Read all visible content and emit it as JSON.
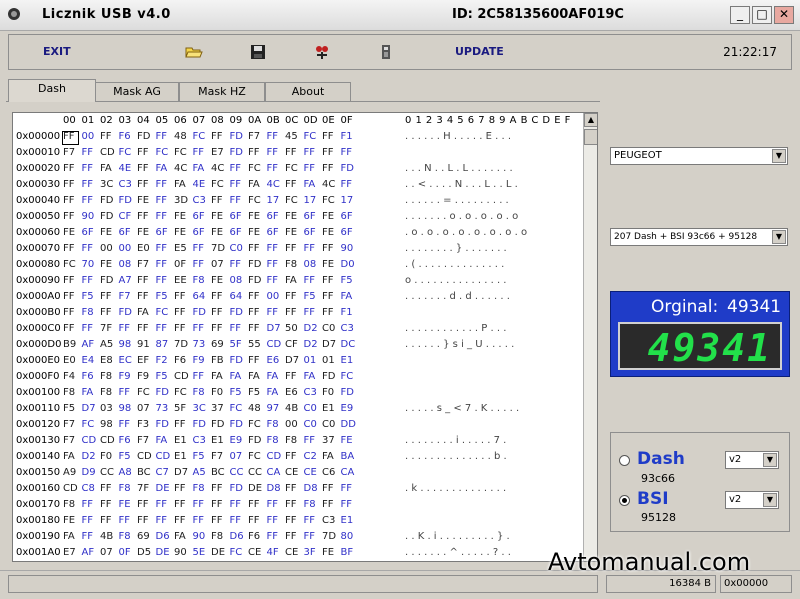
{
  "window": {
    "title": "Licznik USB  v4.0",
    "device_id": "ID:  2C58135600AF019C",
    "minimize": "_",
    "maximize": "□",
    "close": "✕"
  },
  "toolbar": {
    "exit_label": "EXIT",
    "update_label": "UPDATE",
    "clock": "21:22:17",
    "icons": [
      "open-folder-icon",
      "save-disk-icon",
      "connect-icon",
      "device-icon"
    ]
  },
  "tabs": [
    "Dash",
    "Mask AG",
    "Mask HZ",
    "About"
  ],
  "active_tab": "Dash",
  "hex": {
    "col_headers": [
      "00",
      "01",
      "02",
      "03",
      "04",
      "05",
      "06",
      "07",
      "08",
      "09",
      "0A",
      "0B",
      "0C",
      "0D",
      "0E",
      "0F"
    ],
    "ascii_header": "0123456789ABCDEF",
    "rows": [
      {
        "addr": "0x00000",
        "bytes": [
          "FF",
          "00",
          "FF",
          "F6",
          "FD",
          "FF",
          "48",
          "FC",
          "FF",
          "FD",
          "F7",
          "FF",
          "45",
          "FC",
          "FF",
          "F1"
        ],
        "ascii": ". . . . . . H . . . . . E . . ."
      },
      {
        "addr": "0x00010",
        "bytes": [
          "F7",
          "FF",
          "CD",
          "FC",
          "FF",
          "FC",
          "FC",
          "FF",
          "E7",
          "FD",
          "FF",
          "FF",
          "FF",
          "FF",
          "FF",
          "FF"
        ],
        "ascii": ""
      },
      {
        "addr": "0x00020",
        "bytes": [
          "FF",
          "FF",
          "FA",
          "4E",
          "FF",
          "FA",
          "4C",
          "FA",
          "4C",
          "FF",
          "FC",
          "FF",
          "FC",
          "FF",
          "FF",
          "FD"
        ],
        "ascii": ". . . N . . L . L . . . . . . ."
      },
      {
        "addr": "0x00030",
        "bytes": [
          "FF",
          "FF",
          "3C",
          "C3",
          "FF",
          "FF",
          "FA",
          "4E",
          "FC",
          "FF",
          "FA",
          "4C",
          "FF",
          "FA",
          "4C",
          "FF"
        ],
        "ascii": ". . < . . . . N . . . L . . L ."
      },
      {
        "addr": "0x00040",
        "bytes": [
          "FF",
          "FF",
          "FD",
          "FD",
          "FE",
          "FF",
          "3D",
          "C3",
          "FF",
          "FF",
          "FC",
          "17",
          "FC",
          "17",
          "FC",
          "17"
        ],
        "ascii": ". . . . . . = . . . . . . . . ."
      },
      {
        "addr": "0x00050",
        "bytes": [
          "FF",
          "90",
          "FD",
          "CF",
          "FF",
          "FF",
          "FE",
          "6F",
          "FE",
          "6F",
          "FE",
          "6F",
          "FE",
          "6F",
          "FE",
          "6F"
        ],
        "ascii": ". . . . . . . o . o . o . o . o"
      },
      {
        "addr": "0x00060",
        "bytes": [
          "FE",
          "6F",
          "FE",
          "6F",
          "FE",
          "6F",
          "FE",
          "6F",
          "FE",
          "6F",
          "FE",
          "6F",
          "FE",
          "6F",
          "FE",
          "6F"
        ],
        "ascii": ". o . o . o . o . o . o . o . o"
      },
      {
        "addr": "0x00070",
        "bytes": [
          "FF",
          "FF",
          "00",
          "00",
          "E0",
          "FF",
          "E5",
          "FF",
          "7D",
          "C0",
          "FF",
          "FF",
          "FF",
          "FF",
          "FF",
          "90"
        ],
        "ascii": ". . . . . . . . } . . . . . . ."
      },
      {
        "addr": "0x00080",
        "bytes": [
          "FC",
          "70",
          "FE",
          "08",
          "F7",
          "FF",
          "0F",
          "FF",
          "07",
          "FF",
          "FD",
          "FF",
          "F8",
          "08",
          "FE",
          "D0"
        ],
        "ascii": ". ( . . . . . . . . . . . . . ."
      },
      {
        "addr": "0x00090",
        "bytes": [
          "FF",
          "FF",
          "FD",
          "A7",
          "FF",
          "FF",
          "EE",
          "F8",
          "FE",
          "08",
          "FD",
          "FF",
          "FA",
          "FF",
          "FF",
          "F5"
        ],
        "ascii": "o . . . . . . . . . . . . . . ."
      },
      {
        "addr": "0x000A0",
        "bytes": [
          "FF",
          "F5",
          "FF",
          "F7",
          "FF",
          "F5",
          "FF",
          "64",
          "FF",
          "64",
          "FF",
          "00",
          "FF",
          "F5",
          "FF",
          "FA"
        ],
        "ascii": ". . . . . . . d . d . . . . . ."
      },
      {
        "addr": "0x000B0",
        "bytes": [
          "FF",
          "F8",
          "FF",
          "FD",
          "FA",
          "FC",
          "FF",
          "FD",
          "FF",
          "FD",
          "FF",
          "FF",
          "FF",
          "FF",
          "FF",
          "F1"
        ],
        "ascii": ""
      },
      {
        "addr": "0x000C0",
        "bytes": [
          "FF",
          "FF",
          "7F",
          "FF",
          "FF",
          "FF",
          "FF",
          "FF",
          "FF",
          "FF",
          "FF",
          "D7",
          "50",
          "D2",
          "C0",
          "C3"
        ],
        "ascii": ". . . . . . . . . . . . P . . ."
      },
      {
        "addr": "0x000D0",
        "bytes": [
          "B9",
          "AF",
          "A5",
          "98",
          "91",
          "87",
          "7D",
          "73",
          "69",
          "5F",
          "55",
          "CD",
          "CF",
          "D2",
          "D7",
          "DC"
        ],
        "ascii": ". . . . . . } s i _ U . . . . ."
      },
      {
        "addr": "0x000E0",
        "bytes": [
          "E0",
          "E4",
          "E8",
          "EC",
          "EF",
          "F2",
          "F6",
          "F9",
          "FB",
          "FD",
          "FF",
          "E6",
          "D7",
          "01",
          "01",
          "E1"
        ],
        "ascii": ""
      },
      {
        "addr": "0x000F0",
        "bytes": [
          "F4",
          "F6",
          "F8",
          "F9",
          "F9",
          "F5",
          "CD",
          "FF",
          "FA",
          "FA",
          "FA",
          "FA",
          "FF",
          "FA",
          "FD",
          "FC"
        ],
        "ascii": ""
      },
      {
        "addr": "0x00100",
        "bytes": [
          "F8",
          "FA",
          "F8",
          "FF",
          "FC",
          "FD",
          "FC",
          "F8",
          "F0",
          "F5",
          "F5",
          "FA",
          "E6",
          "C3",
          "F0",
          "FD"
        ],
        "ascii": ""
      },
      {
        "addr": "0x00110",
        "bytes": [
          "F5",
          "D7",
          "03",
          "98",
          "07",
          "73",
          "5F",
          "3C",
          "37",
          "FC",
          "48",
          "97",
          "4B",
          "C0",
          "E1",
          "E9"
        ],
        "ascii": ". . . . . s _ < 7 . K . . . . ."
      },
      {
        "addr": "0x00120",
        "bytes": [
          "F7",
          "FC",
          "98",
          "FF",
          "F3",
          "FD",
          "FF",
          "FD",
          "FD",
          "FD",
          "FC",
          "F8",
          "00",
          "C0",
          "C0",
          "DD"
        ],
        "ascii": ""
      },
      {
        "addr": "0x00130",
        "bytes": [
          "F7",
          "CD",
          "CD",
          "F6",
          "F7",
          "FA",
          "E1",
          "C3",
          "E1",
          "E9",
          "FD",
          "F8",
          "F8",
          "FF",
          "37",
          "FE"
        ],
        "ascii": ". . . . . . . . i . . . . . 7 ."
      },
      {
        "addr": "0x00140",
        "bytes": [
          "FA",
          "D2",
          "F0",
          "F5",
          "CD",
          "CD",
          "E1",
          "F5",
          "F7",
          "07",
          "FC",
          "CD",
          "FF",
          "C2",
          "FA",
          "BA"
        ],
        "ascii": ". . . . . . . . . . . . . . b ."
      },
      {
        "addr": "0x00150",
        "bytes": [
          "A9",
          "D9",
          "CC",
          "A8",
          "BC",
          "C7",
          "D7",
          "A5",
          "BC",
          "CC",
          "CC",
          "CA",
          "CE",
          "CE",
          "C6",
          "CA"
        ],
        "ascii": ""
      },
      {
        "addr": "0x00160",
        "bytes": [
          "CD",
          "C8",
          "FF",
          "F8",
          "7F",
          "DE",
          "FF",
          "F8",
          "FF",
          "FD",
          "DE",
          "D8",
          "FF",
          "D8",
          "FF",
          "FF"
        ],
        "ascii": ". k . . . . . . . . . . . . . ."
      },
      {
        "addr": "0x00170",
        "bytes": [
          "F8",
          "FF",
          "FF",
          "FE",
          "FF",
          "FF",
          "FF",
          "FF",
          "FF",
          "FF",
          "FF",
          "FF",
          "FF",
          "F8",
          "FF",
          "FF"
        ],
        "ascii": ""
      },
      {
        "addr": "0x00180",
        "bytes": [
          "FE",
          "FF",
          "FF",
          "FF",
          "FF",
          "FF",
          "FF",
          "FF",
          "FF",
          "FF",
          "FF",
          "FF",
          "FF",
          "FF",
          "C3",
          "E1"
        ],
        "ascii": ""
      },
      {
        "addr": "0x00190",
        "bytes": [
          "FA",
          "FF",
          "4B",
          "F8",
          "69",
          "D6",
          "FA",
          "90",
          "F8",
          "D6",
          "F6",
          "FF",
          "FF",
          "FF",
          "7D",
          "80"
        ],
        "ascii": ". . K . i . . . . . . . . . } ."
      },
      {
        "addr": "0x001A0",
        "bytes": [
          "E7",
          "AF",
          "07",
          "0F",
          "D5",
          "DE",
          "90",
          "5E",
          "DE",
          "FC",
          "CE",
          "4F",
          "CE",
          "3F",
          "FE",
          "BF"
        ],
        "ascii": ". . . . . . . ^ . . . . . ? . ."
      }
    ]
  },
  "right_panel": {
    "brand_select": "PEUGEOT",
    "model_select": "207 Dash + BSI 93c66 + 95128",
    "original_label": "Orginal:",
    "original_value": "49341",
    "lcd_value": "49341",
    "mode": {
      "dash_label": "Dash",
      "dash_chip": "93c66",
      "dash_version": "v2",
      "bsi_label": "BSI",
      "bsi_chip": "95128",
      "bsi_version": "v2",
      "selected": "BSI"
    }
  },
  "status": {
    "size": "16384 B",
    "offset": "0x00000"
  },
  "watermark": "Avtomanual.com",
  "colors": {
    "counter_blue": "#1f3cc8",
    "lcd_green": "#22e04a",
    "hex_blue": "#3030c8"
  }
}
